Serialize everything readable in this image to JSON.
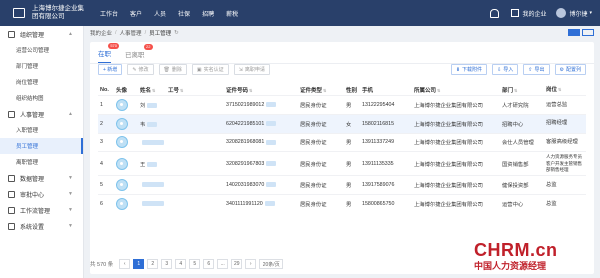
{
  "app": {
    "company": "上海博尔捷企业集团有限公司",
    "nav": [
      "工作台",
      "客户",
      "人员",
      "社保",
      "招聘",
      "薪税"
    ],
    "my_company": "我的企业",
    "user": "博尔捷"
  },
  "sidebar": {
    "groups": [
      {
        "label": "组织管理",
        "items": [
          "运营公司管理",
          "部门管理",
          "岗位管理",
          "组织结构图"
        ]
      },
      {
        "label": "人事管理",
        "items": [
          "入职管理",
          "员工管理",
          "离职管理"
        ]
      },
      {
        "label": "数据管理",
        "items": []
      },
      {
        "label": "审批中心",
        "items": []
      },
      {
        "label": "工作流管理",
        "items": []
      },
      {
        "label": "系统设置",
        "items": []
      }
    ],
    "active_item": "员工管理"
  },
  "breadcrumb": [
    "我的企业",
    "人事管理",
    "员工管理"
  ],
  "tabs": [
    {
      "label": "在职",
      "badge": "570"
    },
    {
      "label": "已离职",
      "badge": "22"
    }
  ],
  "toolbar": {
    "left": [
      {
        "icon": "plus-icon",
        "label": "+ 新增"
      },
      {
        "icon": "edit-icon",
        "label": "修改"
      },
      {
        "icon": "delete-icon",
        "label": "删除"
      },
      {
        "icon": "verify-icon",
        "label": "实名认证"
      },
      {
        "icon": "leave-icon",
        "label": "离职申请"
      }
    ],
    "right": [
      {
        "icon": "download-icon",
        "label": "下载附件"
      },
      {
        "icon": "import-icon",
        "label": "导入"
      },
      {
        "icon": "export-icon",
        "label": "导出"
      },
      {
        "icon": "gear-icon",
        "label": "配置列"
      }
    ]
  },
  "table": {
    "headers": [
      "No.",
      "头像",
      "姓名",
      "工号",
      "证件号码",
      "证件类型",
      "性别",
      "手机",
      "所属公司",
      "部门",
      "岗位"
    ],
    "rows": [
      {
        "no": "1",
        "name": "刘",
        "id_card": "3715021989012",
        "id_type": "居民身份证",
        "sex": "男",
        "phone": "13122295404",
        "company": "上海博尔捷企业集团有限公司",
        "dept": "人才研究院",
        "position": "运营总监"
      },
      {
        "no": "2",
        "name": "韦",
        "id_card": "6204221985101",
        "id_type": "居民身份证",
        "sex": "女",
        "phone": "15802116815",
        "company": "上海博尔捷企业集团有限公司",
        "dept": "招聘中心",
        "position": "招聘经理"
      },
      {
        "no": "3",
        "name": "",
        "id_card": "3208281968081",
        "id_type": "居民身份证",
        "sex": "男",
        "phone": "13911337249",
        "company": "上海博尔捷企业集团有限公司",
        "dept": "会仕人员管理",
        "position": "客服高级经理"
      },
      {
        "no": "4",
        "name": "王",
        "id_card": "3208291967803",
        "id_type": "居民身份证",
        "sex": "男",
        "phone": "13911135335",
        "company": "上海博尔捷企业集团有限公司",
        "dept": "国资销售部",
        "position": "人力资源服务专员客户开发主管销售部销售经理"
      },
      {
        "no": "5",
        "name": "",
        "id_card": "1402031983070",
        "id_type": "居民身份证",
        "sex": "男",
        "phone": "13917589076",
        "company": "上海博尔捷企业集团有限公司",
        "dept": "健保投资部",
        "position": "总监"
      },
      {
        "no": "6",
        "name": "",
        "id_card": "3401111991120",
        "id_type": "居民身份证",
        "sex": "男",
        "phone": "15800865750",
        "company": "上海博尔捷企业集团有限公司",
        "dept": "运营中心",
        "position": "总监"
      }
    ]
  },
  "pager": {
    "total": "共 570 条",
    "pages": [
      "1",
      "2",
      "3",
      "4",
      "5",
      "6",
      "...",
      "29"
    ],
    "current": "1",
    "page_size": "20条/页"
  },
  "watermark": {
    "logo": "CHRM.cn",
    "sub": "中国人力资源经理"
  },
  "colors": {
    "topbar": "#29406a",
    "accent": "#2f6fd6",
    "badge": "#f5504a",
    "watermark": "#c0202a"
  }
}
